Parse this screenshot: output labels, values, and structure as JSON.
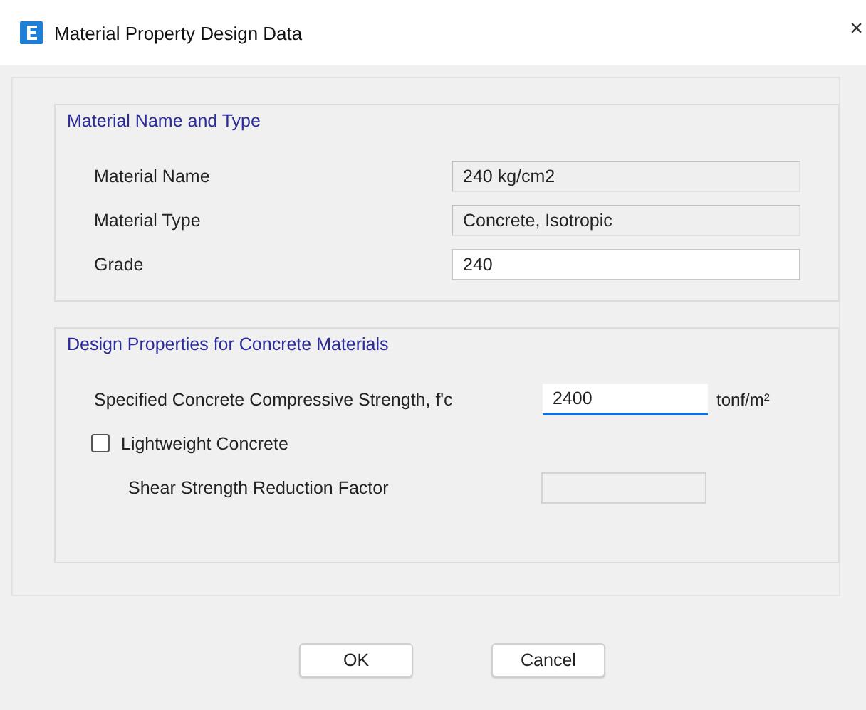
{
  "window": {
    "title": "Material Property Design Data",
    "close": "×"
  },
  "groups": [
    {
      "title": "Material Name and Type",
      "rows": [
        {
          "kind": "field",
          "label": "Material Name",
          "value": "240 kg/cm2",
          "readonly": true,
          "focused": false
        },
        {
          "kind": "field",
          "label": "Material Type",
          "value": "Concrete, Isotropic",
          "readonly": true,
          "focused": false
        },
        {
          "kind": "field",
          "label": "Grade",
          "value": "240",
          "readonly": false,
          "focused": false
        }
      ]
    },
    {
      "title": "Design Properties for Concrete Materials",
      "rows": [
        {
          "kind": "field",
          "label": "Specified Concrete Compressive Strength, f'c",
          "value": "2400",
          "readonly": false,
          "focused": true,
          "unit": "tonf/m²"
        },
        {
          "kind": "checkbox",
          "label": "Lightweight Concrete",
          "checked": false
        },
        {
          "kind": "field",
          "label": "Shear Strength Reduction Factor",
          "value": "",
          "readonly": false,
          "disabled": true,
          "focused": false,
          "indent": true
        }
      ]
    }
  ],
  "buttons": [
    "OK",
    "Cancel"
  ]
}
